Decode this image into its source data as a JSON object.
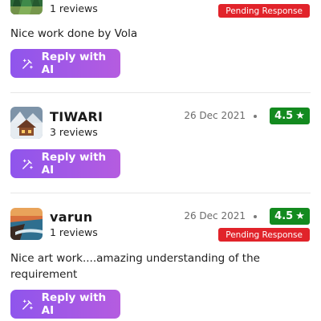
{
  "reviews": [
    {
      "count": "1 reviews",
      "status": "Pending Response",
      "text": "Nice work done by Vola",
      "reply_label": "Reply with AI"
    },
    {
      "name": "TIWARI",
      "count": "3 reviews",
      "date": "26 Dec 2021",
      "rating": "4.5",
      "star": "★",
      "reply_label": "Reply with AI"
    },
    {
      "name": "varun",
      "count": "1 reviews",
      "date": "26 Dec 2021",
      "rating": "4.5",
      "star": "★",
      "status": "Pending Response",
      "text": "Nice art work....amazing understanding of the requirement",
      "reply_label": "Reply with AI"
    }
  ],
  "colors": {
    "rating_bg": "#138a1f",
    "pending_bg": "#e1232a",
    "button_gradient_start": "#8f55ec",
    "button_gradient_end": "#b55ce0"
  },
  "icons": {
    "reply_icon": "magic-wand-icon",
    "rating_icon": "star-icon"
  }
}
